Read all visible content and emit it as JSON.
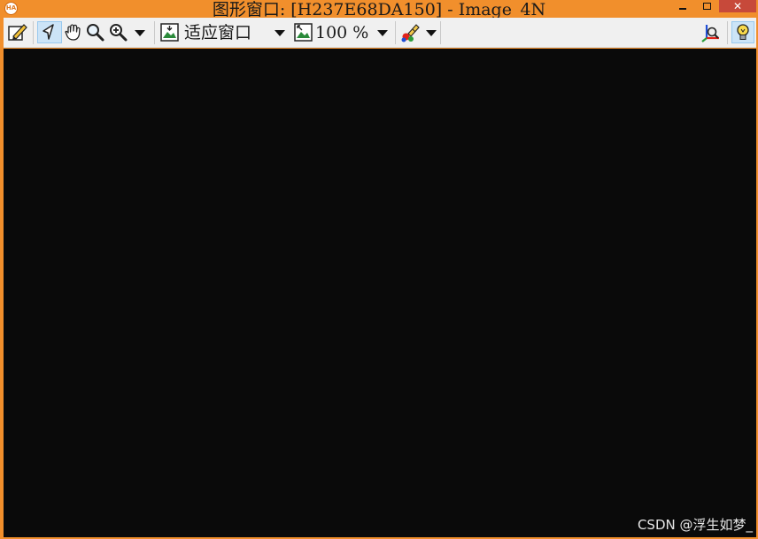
{
  "window": {
    "title": "图形窗口: [H237E68DA150] - Image_4N",
    "app_icon_text": "HA",
    "controls": {
      "minimize_icon": "minimize-icon",
      "maximize_icon": "maximize-icon",
      "close_label": "✕"
    },
    "colors": {
      "frame": "#f18f2c",
      "close": "#c7493a",
      "canvas": "#0a0a0a",
      "toolbar": "#f0f0f0"
    }
  },
  "toolbar": {
    "fit_window_label": "适应窗口",
    "zoom_label": "100 %",
    "tools": [
      {
        "name": "edit-icon",
        "active": false
      },
      {
        "name": "pointer-icon",
        "active": true
      },
      {
        "name": "hand-icon",
        "active": false
      },
      {
        "name": "magnifier-icon",
        "active": false
      },
      {
        "name": "zoom-in-icon",
        "active": false
      },
      {
        "name": "fit-window-icon",
        "active": false
      },
      {
        "name": "zoom-percent-icon",
        "active": false
      },
      {
        "name": "color-brush-icon",
        "active": false
      },
      {
        "name": "axes-icon",
        "active": false
      },
      {
        "name": "lightbulb-icon",
        "active": true
      }
    ]
  },
  "canvas": {
    "watermark": "CSDN @浮生如梦_"
  }
}
